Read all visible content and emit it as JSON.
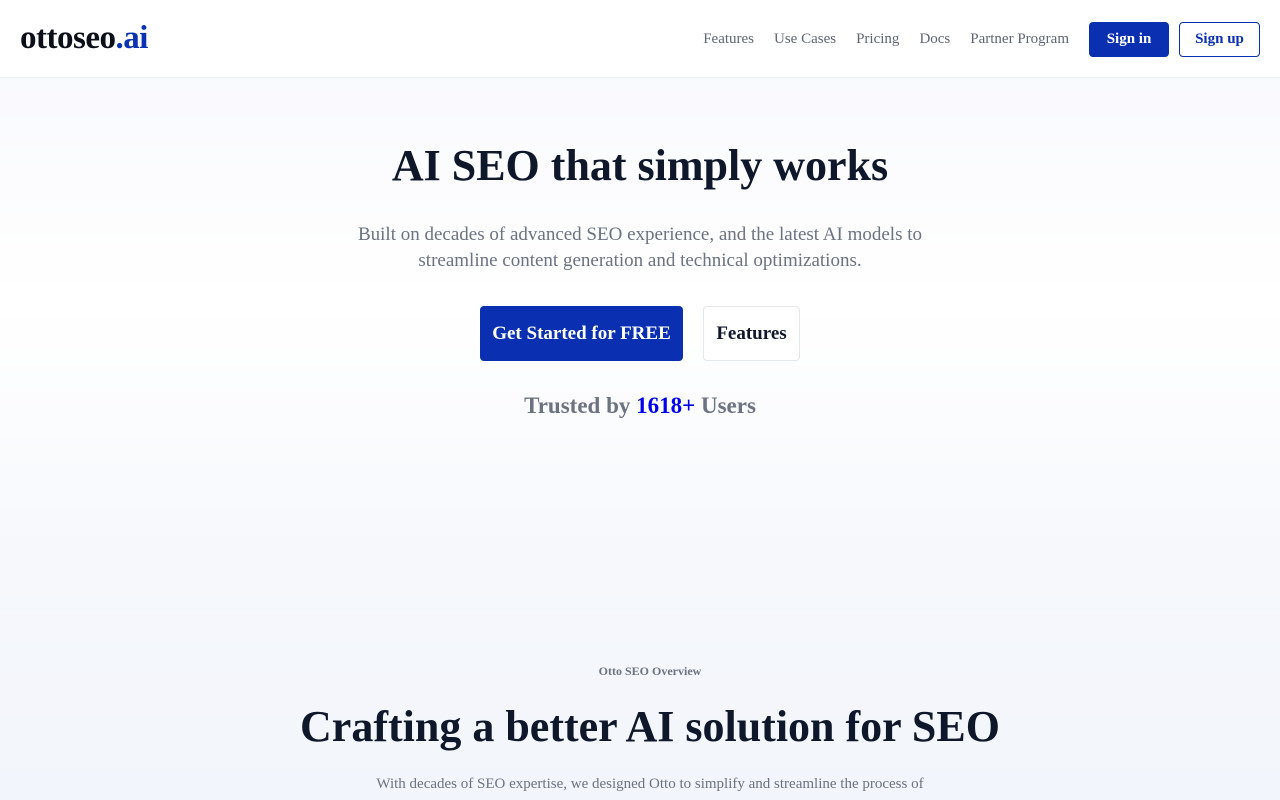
{
  "header": {
    "logo": {
      "name": "ottoseo",
      "tld": ".ai"
    },
    "nav": [
      "Features",
      "Use Cases",
      "Pricing",
      "Docs",
      "Partner Program"
    ],
    "sign_in": "Sign in",
    "sign_up": "Sign up"
  },
  "hero": {
    "title": "AI SEO that simply works",
    "subtitle": "Built on decades of advanced SEO experience, and the latest AI models to streamline content generation and technical optimizations.",
    "cta_primary": "Get Started for FREE",
    "cta_secondary": "Features",
    "trusted_prefix": "Trusted by ",
    "trusted_count": "1618+",
    "trusted_suffix": " Users"
  },
  "overview": {
    "eyebrow": "Otto SEO Overview",
    "title": "Crafting a better AI solution for SEO",
    "subtitle": "With decades of SEO expertise, we designed Otto to simplify and streamline the process of"
  },
  "colors": {
    "brand": "#0a2fb0",
    "text": "#0f172a",
    "muted": "#6b7280",
    "highlight": "#0000ee"
  }
}
